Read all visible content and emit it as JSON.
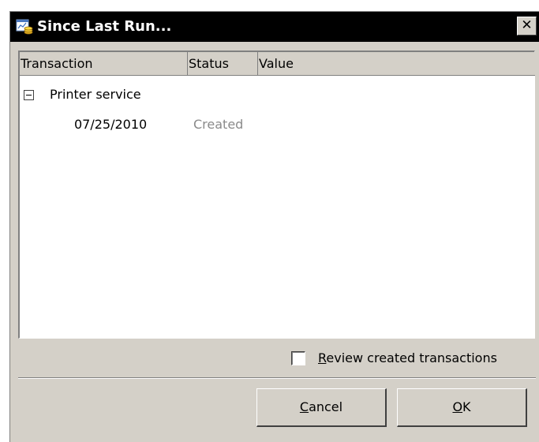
{
  "window": {
    "title": "Since Last Run...",
    "close_label": "✕"
  },
  "list": {
    "columns": [
      "Transaction",
      "Status",
      "Value"
    ],
    "groups": [
      {
        "label": "Printer service",
        "expanded": true,
        "rows": [
          {
            "transaction": "07/25/2010",
            "status": "Created",
            "value": ""
          }
        ]
      }
    ]
  },
  "review_checkbox": {
    "checked": false,
    "accel": "R",
    "label_rest": "eview created transactions"
  },
  "buttons": {
    "cancel": {
      "accel": "C",
      "rest": "ancel"
    },
    "ok": {
      "accel": "O",
      "rest": "K"
    }
  },
  "colors": {
    "titlebar_bg": "#000000",
    "dialog_bg": "#d4d0c8",
    "muted_text": "#8a8a8a"
  }
}
